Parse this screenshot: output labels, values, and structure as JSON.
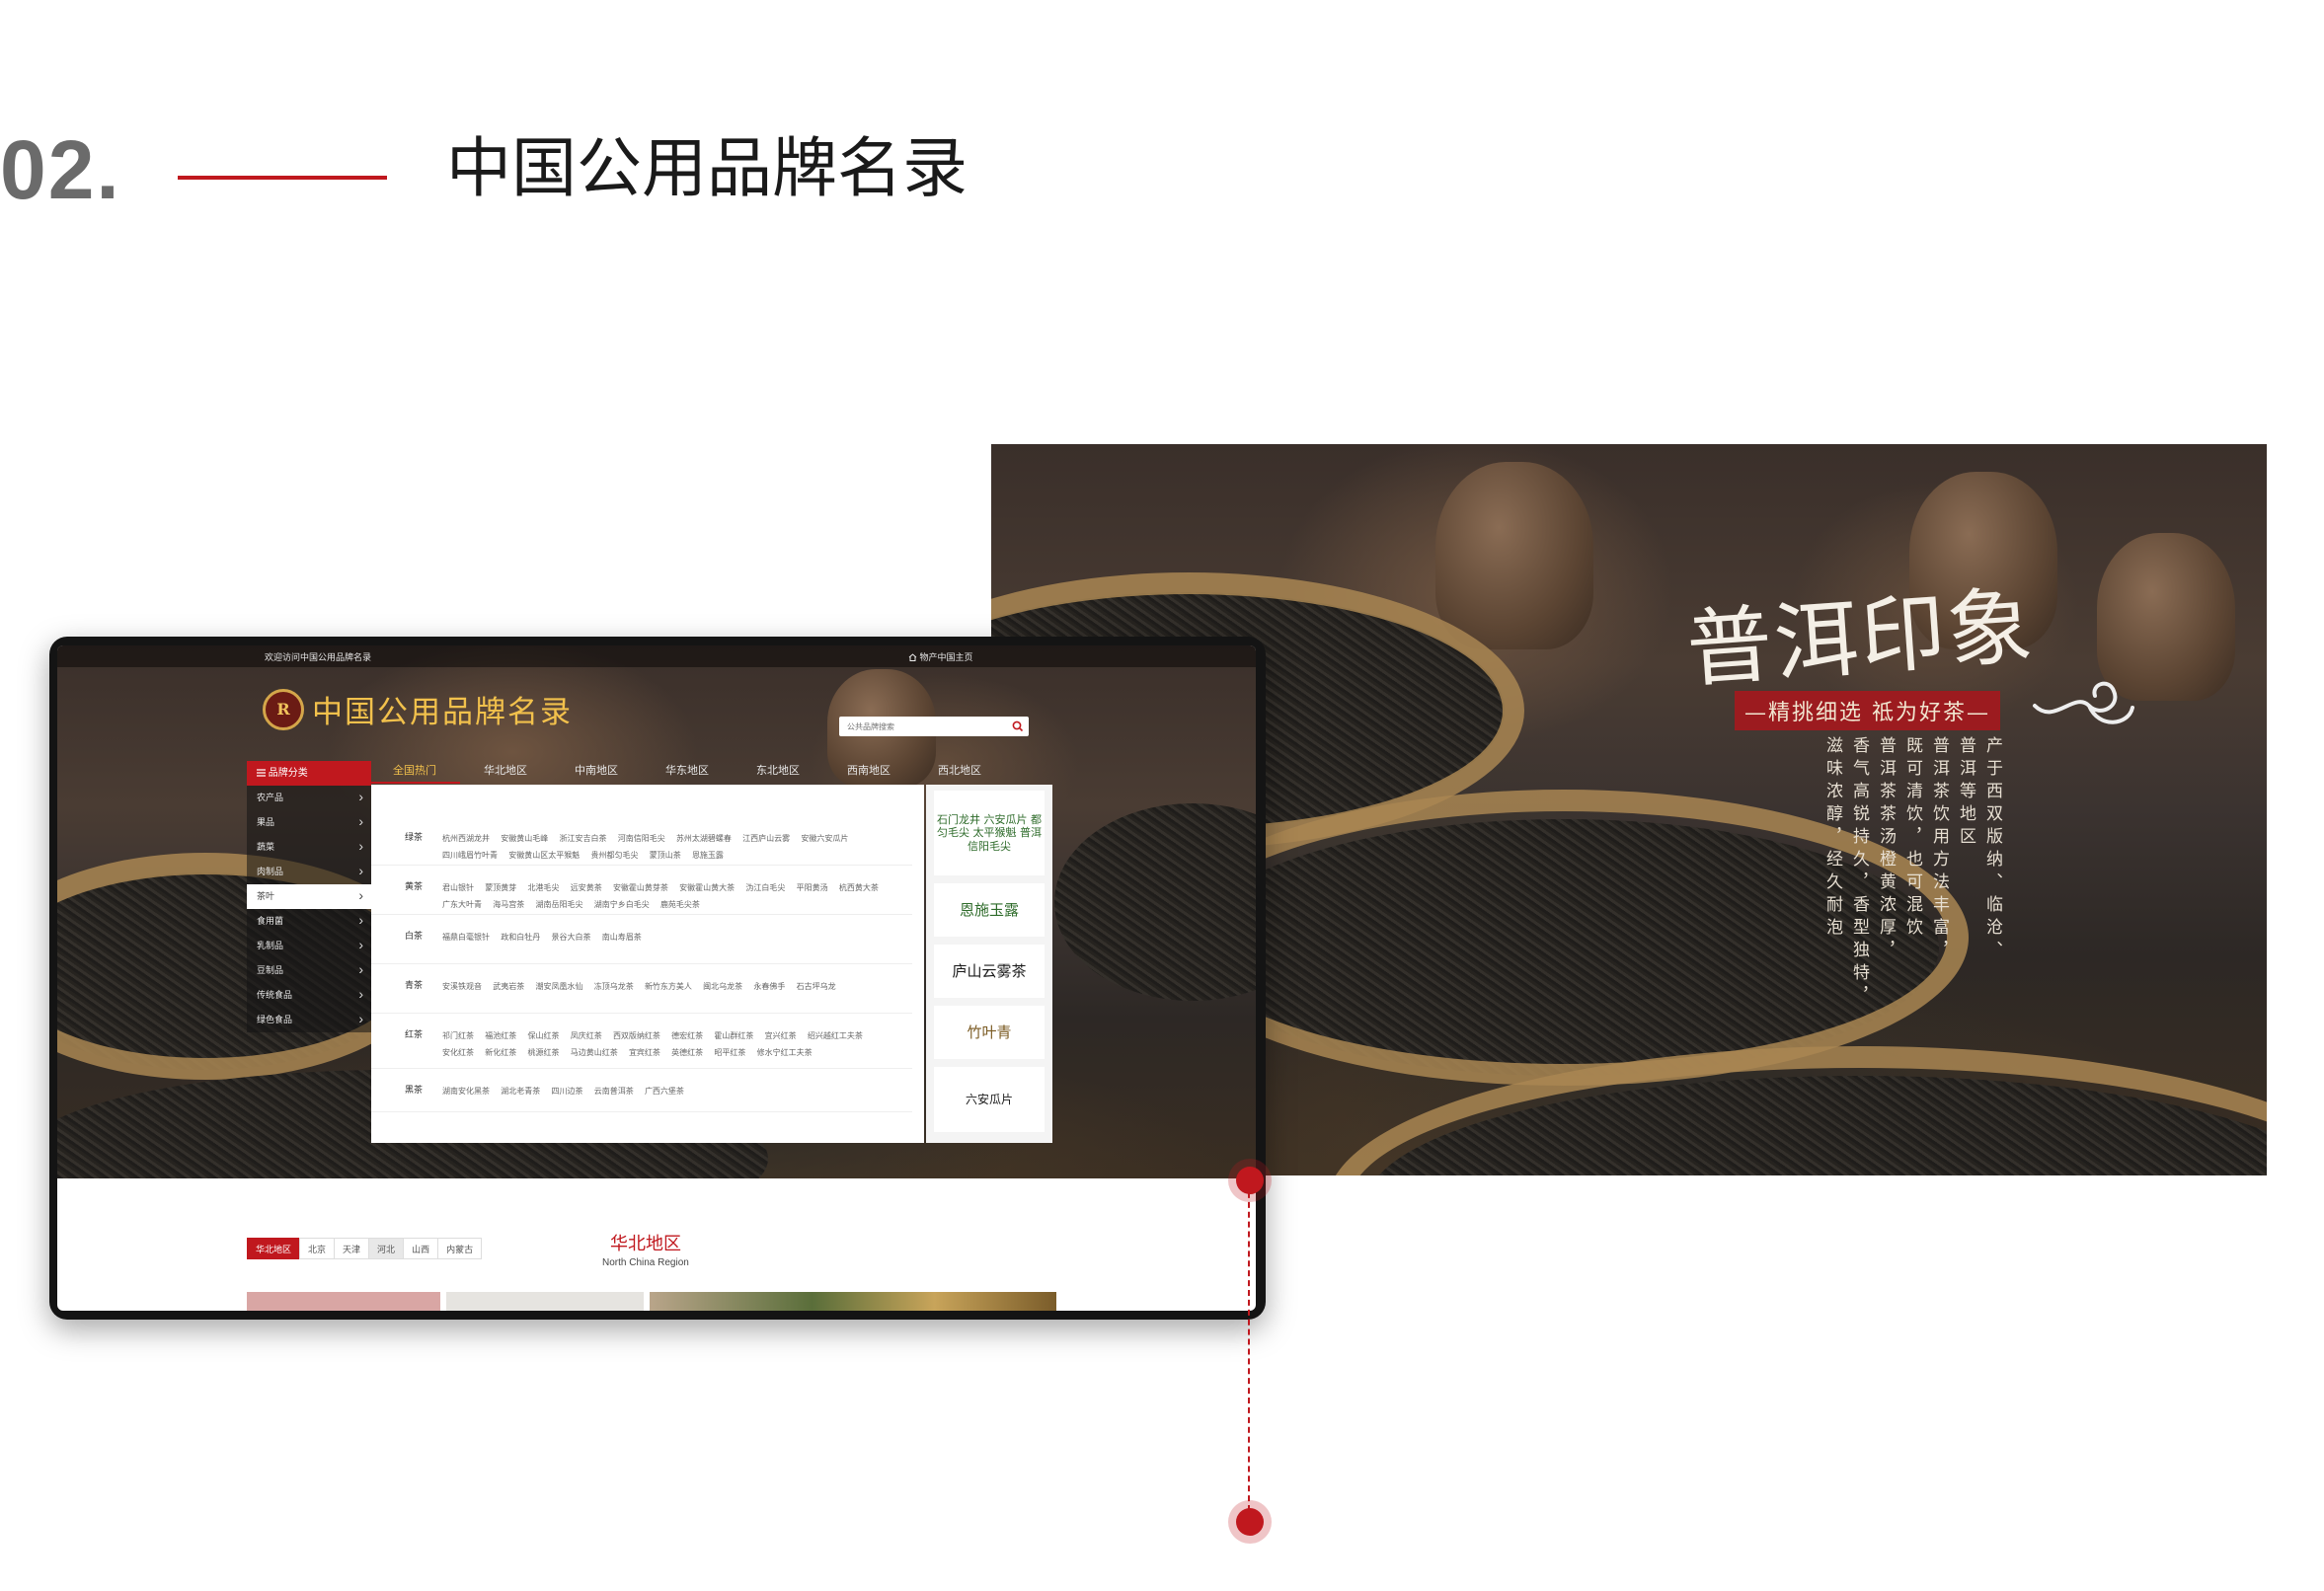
{
  "header": {
    "number": "02.",
    "title": "中国公用品牌名录"
  },
  "banner": {
    "title": "普洱印象",
    "slogan": "—精挑细选  祗为好茶—",
    "poem": [
      "产于西双版纳、临沧、",
      "普洱等地区",
      "普洱茶饮用方法丰富，",
      "既可清饮，也可混饮",
      "普洱茶茶汤橙黄浓厚，",
      "香气高锐持久，香型独特，",
      "滋味浓醇，经久耐泡"
    ]
  },
  "site": {
    "topbar": {
      "welcome": "欢迎访问中国公用品牌名录",
      "home": "物产中国主页"
    },
    "logo": {
      "badge": "R",
      "text": "中国公用品牌名录"
    },
    "search": {
      "placeholder": "公共品牌搜索"
    },
    "nav": [
      "全国热门",
      "华北地区",
      "中南地区",
      "华东地区",
      "东北地区",
      "西南地区",
      "西北地区"
    ],
    "side_menu": {
      "head": "品牌分类",
      "items": [
        "农产品",
        "果品",
        "蔬菜",
        "肉制品",
        "茶叶",
        "食用菌",
        "乳制品",
        "豆制品",
        "传统食品",
        "绿色食品"
      ]
    },
    "mega": [
      {
        "cat": "绿茶",
        "list": [
          "杭州西湖龙井",
          "安徽黄山毛峰",
          "浙江安吉白茶",
          "河南信阳毛尖",
          "苏州太湖碧螺春",
          "江西庐山云雾",
          "安徽六安瓜片",
          "四川峨眉竹叶青",
          "安徽黄山区太平猴魁",
          "贵州都匀毛尖",
          "蒙顶山茶",
          "恩施玉露"
        ]
      },
      {
        "cat": "黄茶",
        "list": [
          "君山银针",
          "蒙顶黄芽",
          "北港毛尖",
          "远安黄茶",
          "安徽霍山黄芽茶",
          "安徽霍山黄大茶",
          "沩江白毛尖",
          "平阳黄汤",
          "杭西黄大茶",
          "广东大叶青",
          "海马宫茶",
          "湖南岳阳毛尖",
          "湖南宁乡白毛尖",
          "鹿苑毛尖茶"
        ]
      },
      {
        "cat": "白茶",
        "list": [
          "福鼎白毫银针",
          "政和白牡丹",
          "景谷大白茶",
          "南山寿眉茶"
        ]
      },
      {
        "cat": "青茶",
        "list": [
          "安溪铁观音",
          "武夷岩茶",
          "潮安凤凰水仙",
          "冻顶乌龙茶",
          "新竹东方美人",
          "闽北乌龙茶",
          "永春佛手",
          "石古坪乌龙"
        ]
      },
      {
        "cat": "红茶",
        "list": [
          "祁门红茶",
          "福池红茶",
          "保山红茶",
          "凤庆红茶",
          "西双版纳红茶",
          "德宏红茶",
          "霍山群红茶",
          "宜兴红茶",
          "绍兴越红工夫茶",
          "安化红茶",
          "新化红茶",
          "桃源红茶",
          "马边黄山红茶",
          "宜宾红茶",
          "英德红茶",
          "昭平红茶",
          "修水宁红工夫茶"
        ]
      },
      {
        "cat": "黑茶",
        "list": [
          "湖南安化黑茶",
          "湖北老青茶",
          "四川边茶",
          "云南普洱茶",
          "广西六堡茶"
        ]
      }
    ],
    "brands": [
      "石门龙井  六安瓜片",
      "都匀毛尖  太平猴魁  普洱  信阳毛尖",
      "恩施玉露",
      "庐山云雾茶",
      "竹叶青",
      "六安瓜片"
    ],
    "region": {
      "title": "华北地区",
      "subtitle": "North China Region",
      "tabs": [
        "华北地区",
        "北京",
        "天津",
        "河北",
        "山西",
        "内蒙古"
      ]
    }
  },
  "colors": {
    "accent": "#c0181e",
    "gold": "#f2c14c",
    "section_number": "#6b6b6b"
  }
}
